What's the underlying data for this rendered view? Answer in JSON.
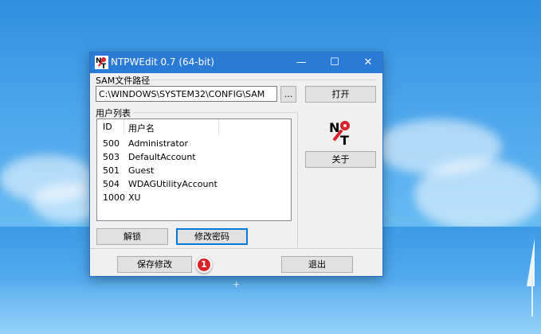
{
  "window": {
    "title": "NTPWEdit 0.7 (64-bit)",
    "controls": {
      "minimize": "—",
      "maximize": "☐",
      "close": "✕"
    }
  },
  "sam": {
    "label": "SAM文件路径",
    "path": "C:\\WINDOWS\\SYSTEM32\\CONFIG\\SAM",
    "browse_label": "...",
    "open_label": "打开"
  },
  "users": {
    "label": "用户列表",
    "columns": [
      "ID",
      "用户名"
    ],
    "rows": [
      {
        "id": "500",
        "name": "Administrator"
      },
      {
        "id": "503",
        "name": "DefaultAccount"
      },
      {
        "id": "501",
        "name": "Guest"
      },
      {
        "id": "504",
        "name": "WDAGUtilityAccount"
      },
      {
        "id": "1000",
        "name": "XU"
      }
    ]
  },
  "buttons": {
    "unlock": "解锁",
    "change_password": "修改密码",
    "about": "关于",
    "save": "保存修改",
    "exit": "退出"
  },
  "annotation": {
    "step": "1"
  },
  "colors": {
    "titlebar": "#2b7bd6",
    "badge": "#d8232a",
    "focus": "#0078d7"
  }
}
